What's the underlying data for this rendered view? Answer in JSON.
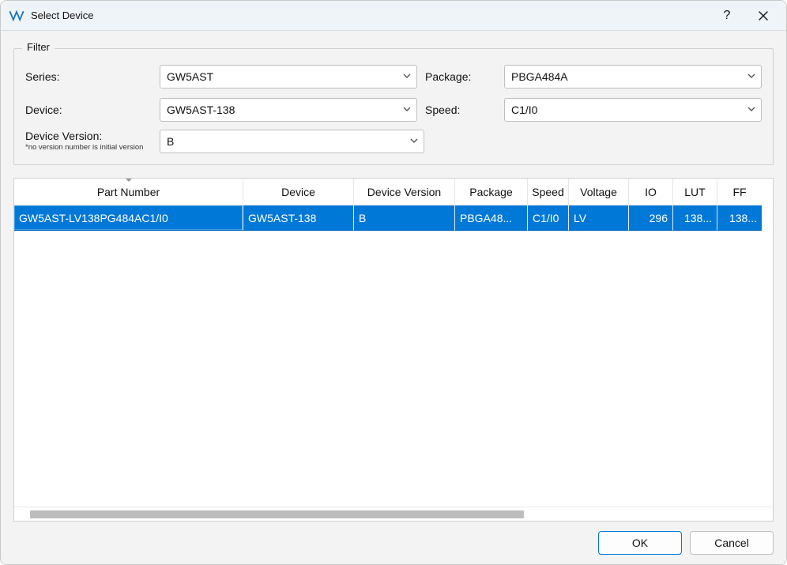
{
  "window": {
    "title": "Select Device"
  },
  "filter": {
    "legend": "Filter",
    "labels": {
      "series": "Series:",
      "device": "Device:",
      "package": "Package:",
      "speed": "Speed:",
      "device_version": "Device Version:",
      "device_version_note": "*no version number is initial version"
    },
    "values": {
      "series": "GW5AST",
      "device": "GW5AST-138",
      "package": "PBGA484A",
      "speed": "C1/I0",
      "device_version": "B"
    }
  },
  "table": {
    "headers": {
      "part_number": "Part Number",
      "device": "Device",
      "device_version": "Device Version",
      "package": "Package",
      "speed": "Speed",
      "voltage": "Voltage",
      "io": "IO",
      "lut": "LUT",
      "ff": "FF"
    },
    "rows": [
      {
        "part_number": "GW5AST-LV138PG484AC1/I0",
        "device": "GW5AST-138",
        "device_version": "B",
        "package": "PBGA48...",
        "speed": "C1/I0",
        "voltage": "LV",
        "io": "296",
        "lut": "138...",
        "ff": "138..."
      }
    ]
  },
  "buttons": {
    "ok": "OK",
    "cancel": "Cancel"
  }
}
